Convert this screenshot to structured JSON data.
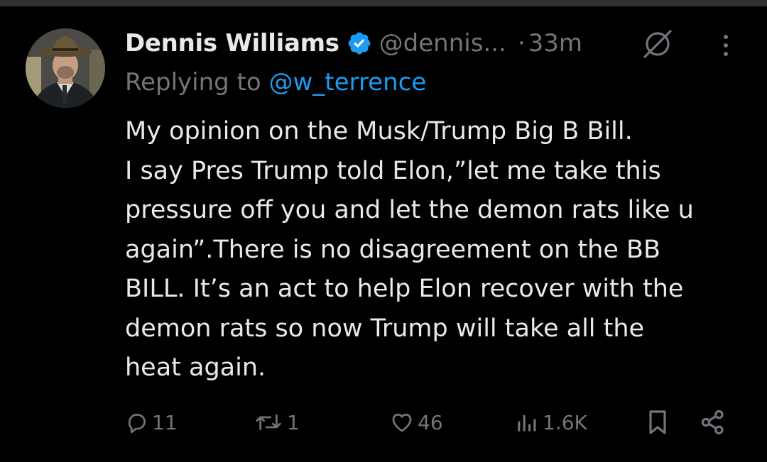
{
  "tweet": {
    "author_name": "Dennis Williams",
    "handle": "@dennis...",
    "separator": "·",
    "time": "33m",
    "replying_prefix": "Replying to ",
    "replying_to": "@w_terrence",
    "body_lines": [
      "My opinion on the Musk/Trump Big B Bill.",
      "I say Pres Trump told Elon,”let me take this",
      "pressure off you and let the demon rats like u",
      "again”.There is no disagreement on the BB",
      "BILL.  It’s an act to help Elon recover with the",
      "demon rats so now Trump will take all the",
      "heat again."
    ]
  },
  "actions": {
    "reply_count": "11",
    "repost_count": "1",
    "like_count": "46",
    "views_count": "1.6K"
  },
  "icons": {
    "verified": "verified-badge-icon",
    "grok": "grok-icon",
    "more": "more-options-icon",
    "reply": "reply-icon",
    "repost": "repost-icon",
    "like": "heart-icon",
    "views": "views-chart-icon",
    "bookmark": "bookmark-icon",
    "share": "share-icon"
  },
  "colors": {
    "background": "#000000",
    "text": "#e7e9ea",
    "muted": "#71767b",
    "accent": "#1d9bf0"
  }
}
